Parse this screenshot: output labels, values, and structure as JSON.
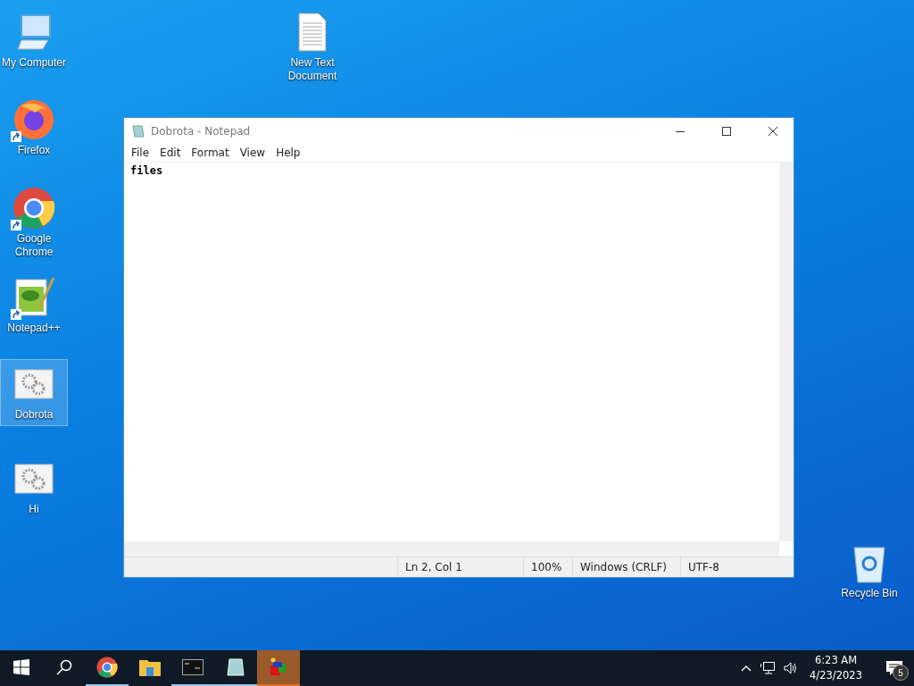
{
  "desktop_icons": [
    {
      "label": "My Computer",
      "kind": "computer",
      "shortcut": false,
      "selected": false
    },
    {
      "label": "New Text Document",
      "kind": "textfile",
      "shortcut": false,
      "selected": false
    },
    {
      "label": "Firefox",
      "kind": "firefox",
      "shortcut": true,
      "selected": false
    },
    {
      "label": "Google Chrome",
      "kind": "chrome",
      "shortcut": true,
      "selected": false
    },
    {
      "label": "Notepad++",
      "kind": "notepadpp",
      "shortcut": true,
      "selected": false
    },
    {
      "label": "Dobrota",
      "kind": "program",
      "shortcut": false,
      "selected": true
    },
    {
      "label": "Hi",
      "kind": "program",
      "shortcut": false,
      "selected": false
    },
    {
      "label": "Recycle Bin",
      "kind": "recycle",
      "shortcut": false,
      "selected": false
    }
  ],
  "window": {
    "title": "Dobrota - Notepad",
    "menu": [
      "File",
      "Edit",
      "Format",
      "View",
      "Help"
    ],
    "content": "files",
    "status_bar": [
      "Ln 2, Col 1",
      "100%",
      "Windows (CRLF)",
      "UTF-8"
    ]
  },
  "taskbar": {
    "apps": [
      {
        "kind": "chrome",
        "running": true,
        "active": false
      },
      {
        "kind": "explorer",
        "running": false,
        "active": false
      },
      {
        "kind": "console",
        "running": true,
        "active": false
      },
      {
        "kind": "notepad",
        "running": true,
        "active": false
      },
      {
        "kind": "program",
        "running": true,
        "active": true
      }
    ],
    "time": "6:23 AM",
    "date": "4/23/2023",
    "notification_count": "5"
  }
}
